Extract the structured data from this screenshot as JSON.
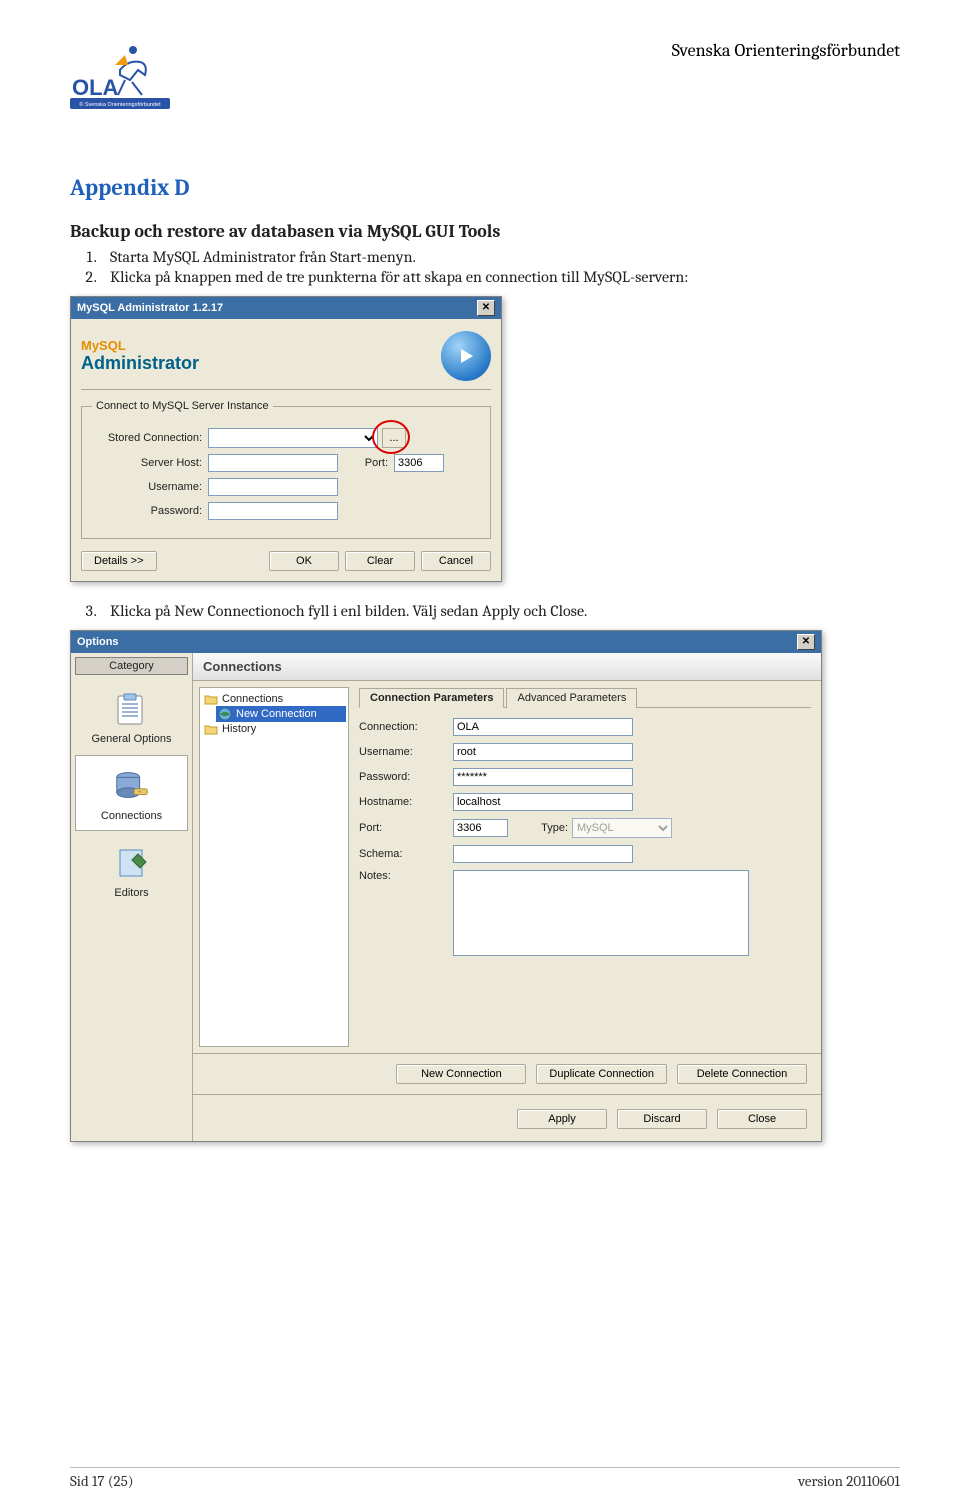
{
  "header": {
    "org_name": "Svenska Orienteringsförbundet",
    "logo_text": "OLA",
    "logo_sub": "© Svenska Orienteringsförbundet"
  },
  "content": {
    "appendix_title": "Appendix D",
    "subtitle": "Backup och restore av databasen via MySQL GUI Tools",
    "step1": "Starta MySQL Administrator från Start-menyn.",
    "step2": "Klicka på knappen med de tre punkterna för att skapa en connection till MySQL-servern:",
    "step3": "Klicka på New Connectionoch fyll i enl bilden. Välj sedan Apply och Close."
  },
  "dialog1": {
    "title": "MySQL Administrator 1.2.17",
    "brand_small": "MySQL",
    "brand_big": "Administrator",
    "groupbox": "Connect to MySQL Server Instance",
    "labels": {
      "stored_connection": "Stored Connection:",
      "server_host": "Server Host:",
      "port": "Port:",
      "username": "Username:",
      "password": "Password:"
    },
    "values": {
      "stored_connection": "",
      "server_host": "",
      "port": "3306",
      "username": "",
      "password": ""
    },
    "ellipsis": "...",
    "buttons": {
      "details": "Details >>",
      "ok": "OK",
      "clear": "Clear",
      "cancel": "Cancel"
    }
  },
  "dialog2": {
    "title": "Options",
    "sidebar": {
      "category": "Category",
      "items": [
        {
          "label": "General Options"
        },
        {
          "label": "Connections"
        },
        {
          "label": "Editors"
        }
      ]
    },
    "main_header": "Connections",
    "tree": {
      "connections": "Connections",
      "new_connection": "New Connection",
      "history": "History"
    },
    "tabs": {
      "conn_params": "Connection Parameters",
      "adv_params": "Advanced Parameters"
    },
    "params": {
      "labels": {
        "connection": "Connection:",
        "username": "Username:",
        "password": "Password:",
        "hostname": "Hostname:",
        "port": "Port:",
        "type": "Type:",
        "schema": "Schema:",
        "notes": "Notes:"
      },
      "values": {
        "connection": "OLA",
        "username": "root",
        "password": "*******",
        "hostname": "localhost",
        "port": "3306",
        "type": "MySQL",
        "schema": "",
        "notes": ""
      }
    },
    "mid_buttons": {
      "new_connection": "New Connection",
      "duplicate_connection": "Duplicate Connection",
      "delete_connection": "Delete Connection"
    },
    "bottom_buttons": {
      "apply": "Apply",
      "discard": "Discard",
      "close": "Close"
    }
  },
  "footer": {
    "page": "Sid 17 (25)",
    "version": "version 20110601"
  }
}
